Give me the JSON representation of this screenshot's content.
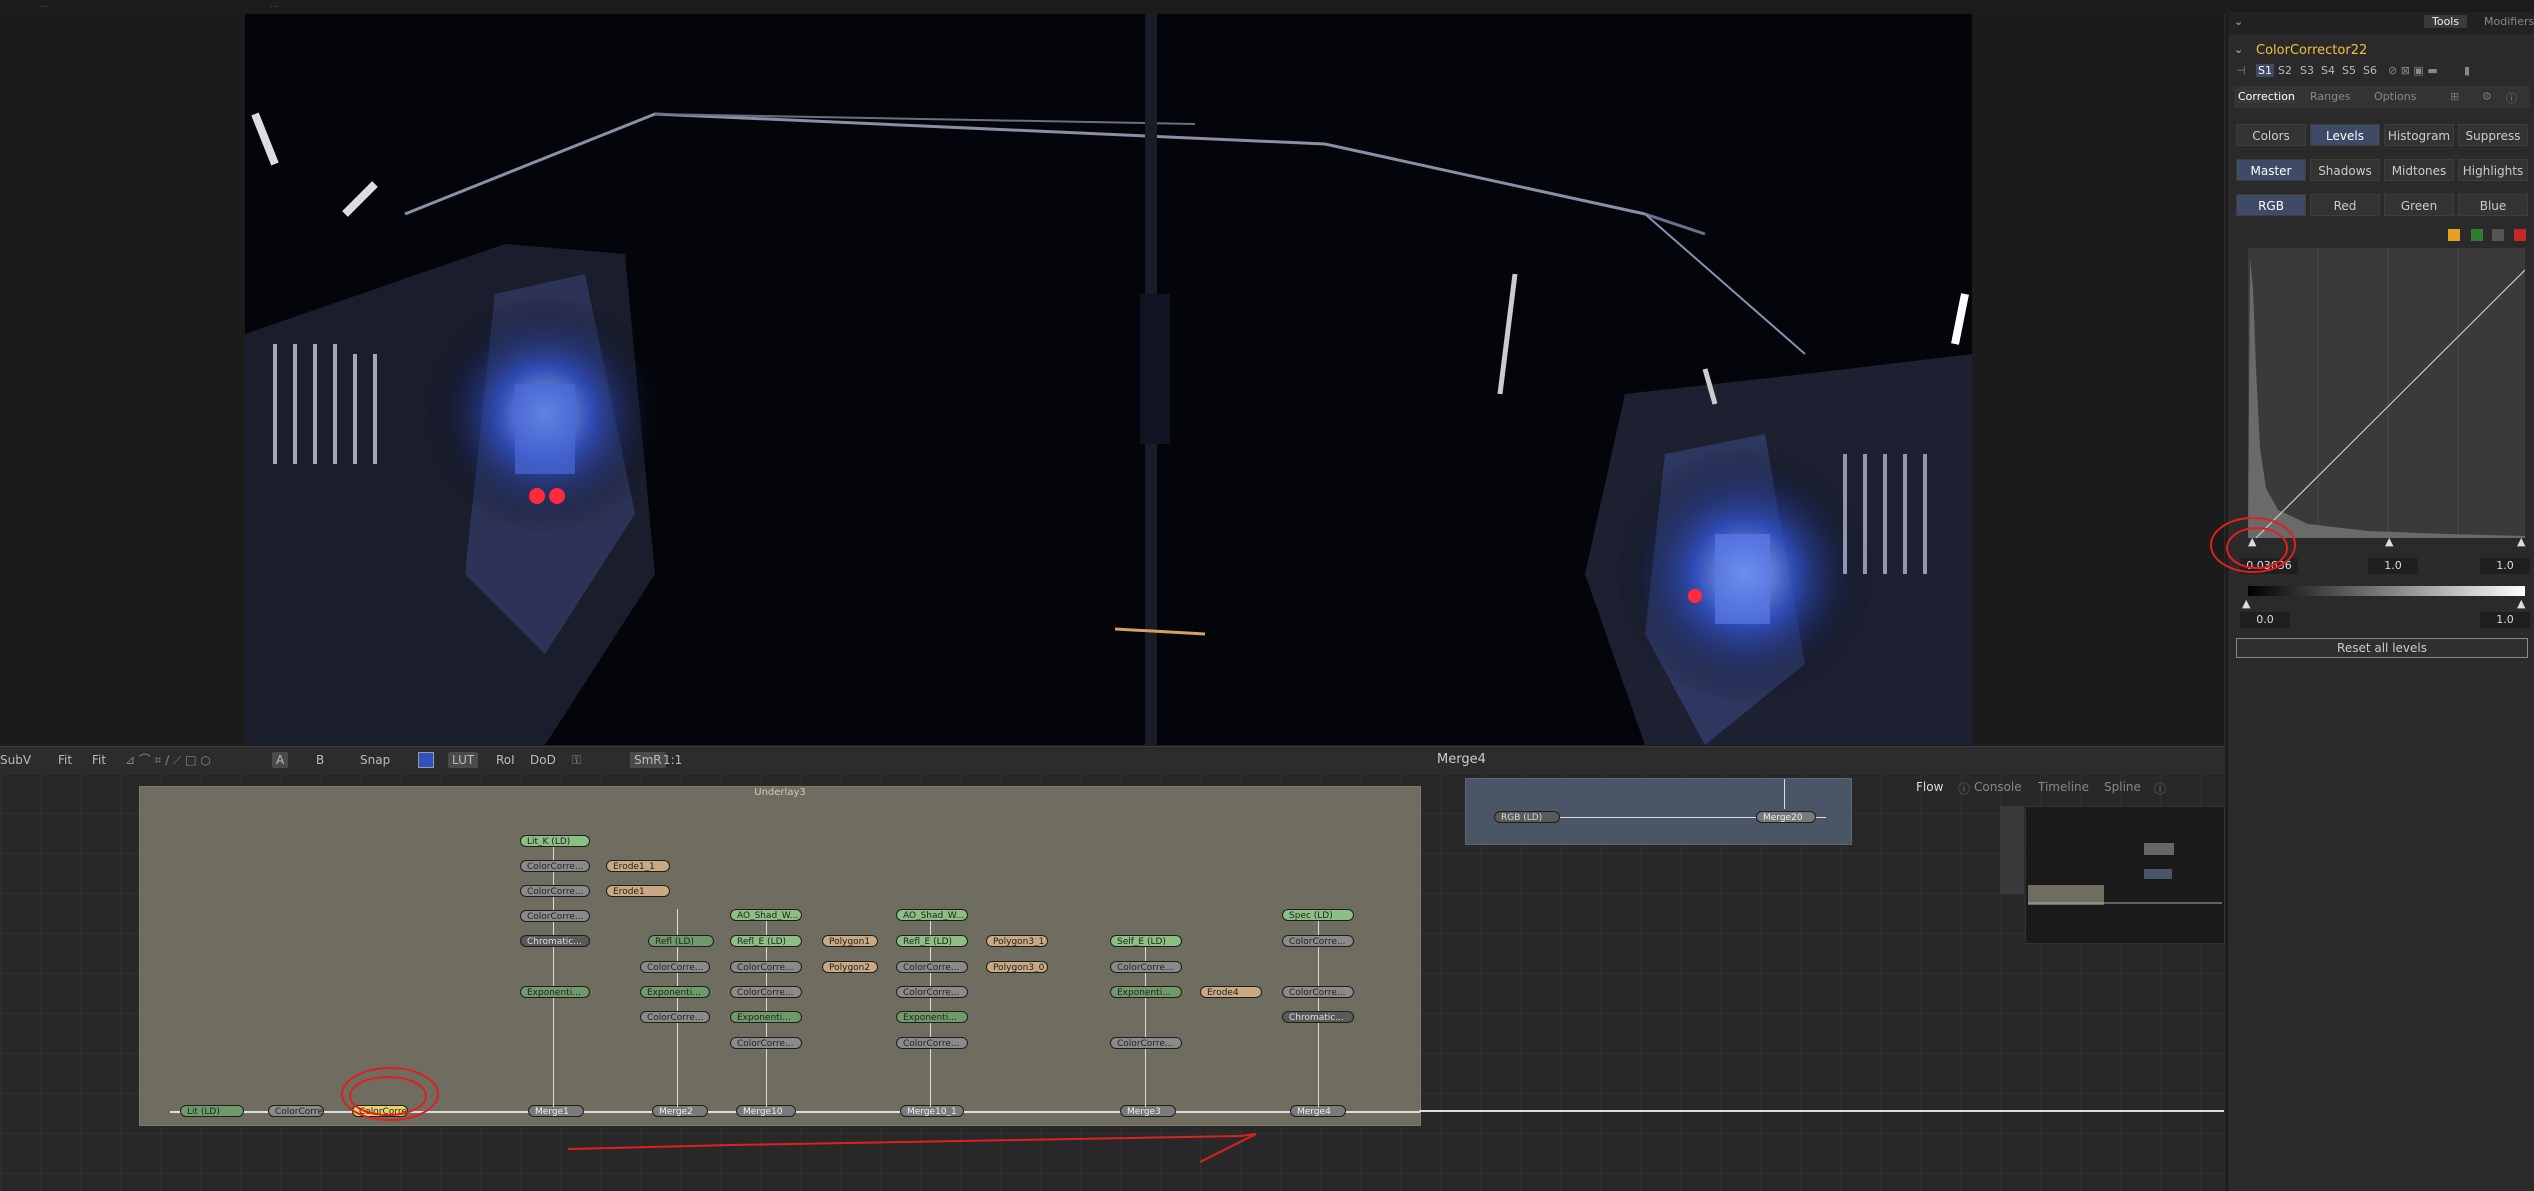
{
  "top_tabs": [
    "...",
    "..."
  ],
  "viewer": {
    "name": "Merge4",
    "toolbar": {
      "subv": "SubV",
      "fit1": "Fit",
      "fit2": "Fit",
      "ab_a": "A",
      "ab_b": "B",
      "snap": "Snap",
      "lut": "LUT",
      "roi": "RoI",
      "dod": "DoD",
      "smr": "SmR",
      "ratio": "1:1"
    }
  },
  "node_editor": {
    "underlay_title": "Underlay3",
    "rgb_group": {
      "rgb_node": "RGB (LD)",
      "merge_node": "Merge20"
    },
    "flow_tabs": [
      "Flow",
      "Console",
      "Timeline",
      "Spline"
    ],
    "nodes": {
      "lit_ld": "Lit (LD)",
      "cc_a": "ColorCorre...",
      "cc_sel": "ColorCorre...",
      "merge1": "Merge1",
      "merge2": "Merge2",
      "merge10": "Merge10",
      "merge10_1": "Merge10_1",
      "merge3": "Merge3",
      "merge4": "Merge4",
      "lit_k": "Lit_K (LD)",
      "cc_1": "ColorCorre...",
      "cc_2": "ColorCorre...",
      "cc_3": "ColorCorre...",
      "chromatic1": "Chromatic...",
      "expo1": "Exponenti...",
      "blur1": "Erode1_1",
      "blur2": "Erode1",
      "refl": "Refl (LD)",
      "cc_r1": "ColorCorre...",
      "expo_r": "Exponenti...",
      "cc_r2": "ColorCorre...",
      "ao_shad": "AO_Shad_W...",
      "refl_e": "Refl_E (LD)",
      "cc_b1": "ColorCorre...",
      "cc_b2": "ColorCorre...",
      "expo_b": "Exponenti...",
      "cc_b3": "ColorCorre...",
      "poly1": "Polygon1",
      "poly2": "Polygon2",
      "ao_shad2": "AO_Shad_W...",
      "refl_e2": "Refl_E (LD)",
      "cc_c1": "ColorCorre...",
      "cc_c2": "ColorCorre...",
      "expo_c": "Exponenti...",
      "cc_c3": "ColorCorre...",
      "poly3": "Polygon3_1",
      "poly4": "Polygon3_0",
      "self_e": "Self_E (LD)",
      "cc_d1": "ColorCorre...",
      "expo_d": "Exponenti...",
      "cc_d2": "ColorCorre...",
      "erode": "Erode4",
      "spec": "Spec (LD)",
      "cc_e1": "ColorCorre...",
      "cc_e2": "ColorCorre...",
      "chromatic2": "Chromatic..."
    }
  },
  "inspector": {
    "header_tabs": [
      "Tools",
      "Modifiers"
    ],
    "tool_name": "ColorCorrector22",
    "versions": [
      "S1",
      "S2",
      "S3",
      "S4",
      "S5",
      "S6"
    ],
    "tabs": [
      "Correction",
      "Ranges",
      "Options"
    ],
    "mode_buttons": [
      "Colors",
      "Levels",
      "Histogram",
      "Suppress"
    ],
    "range_buttons": [
      "Master",
      "Shadows",
      "Midtones",
      "Highlights"
    ],
    "channel_buttons": [
      "RGB",
      "Red",
      "Green",
      "Blue"
    ],
    "input_levels": {
      "low": "0.03636",
      "mid": "1.0",
      "high": "1.0"
    },
    "output_levels": {
      "low": "0.0",
      "high": "1.0"
    },
    "reset_label": "Reset all levels",
    "colors": {
      "accent": "#f0c040",
      "active_button": "#3e4a66"
    }
  }
}
